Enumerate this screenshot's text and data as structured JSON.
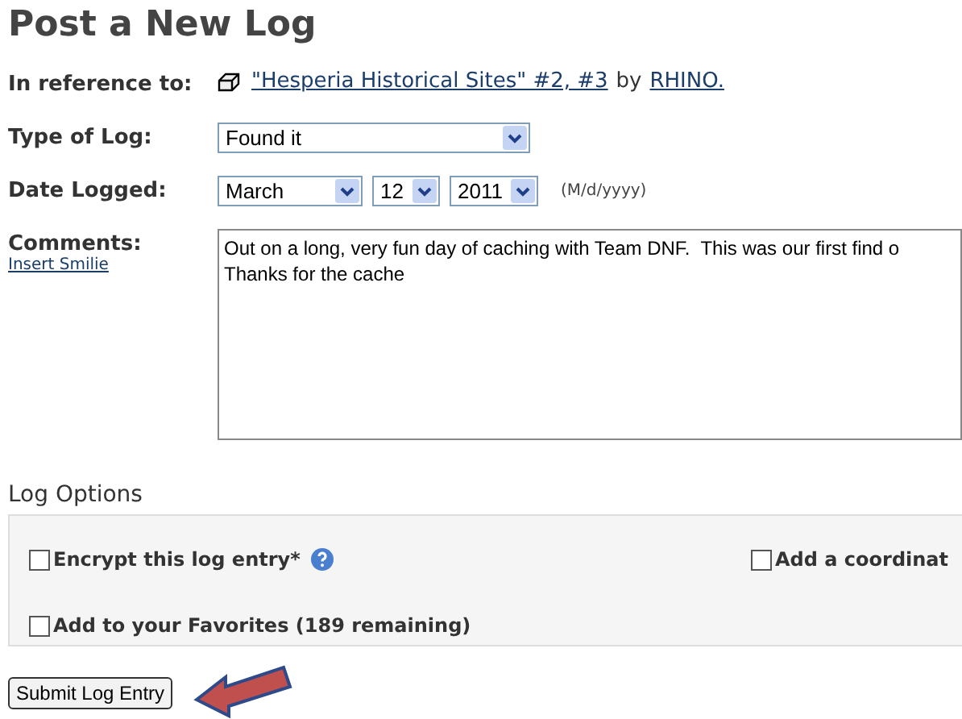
{
  "title": "Post a New Log",
  "reference": {
    "label": "In reference to:",
    "cache_link": "\"Hesperia Historical Sites\" #2, #3",
    "by": "by",
    "owner_link": "RHINO."
  },
  "log_type": {
    "label": "Type of Log:",
    "value": "Found it"
  },
  "date": {
    "label": "Date Logged:",
    "month": "March",
    "day": "12",
    "year": "2011",
    "hint": "(M/d/yyyy)"
  },
  "comments": {
    "label": "Comments:",
    "smilie_link": "Insert Smilie",
    "lines": [
      "Out on a long, very fun day of caching with Team DNF.  This was our first find o",
      "Thanks for the cache"
    ]
  },
  "log_options": {
    "title": "Log Options",
    "rows": [
      {
        "options": [
          {
            "label": "Encrypt this log entry*",
            "checked": false,
            "help": true
          },
          {
            "label": "Add a coordinat",
            "checked": false,
            "help": false
          }
        ]
      },
      {
        "options": [
          {
            "label": "Add to your Favorites (189 remaining)",
            "checked": false,
            "help": false
          }
        ]
      }
    ]
  },
  "submit": "Submit Log Entry"
}
